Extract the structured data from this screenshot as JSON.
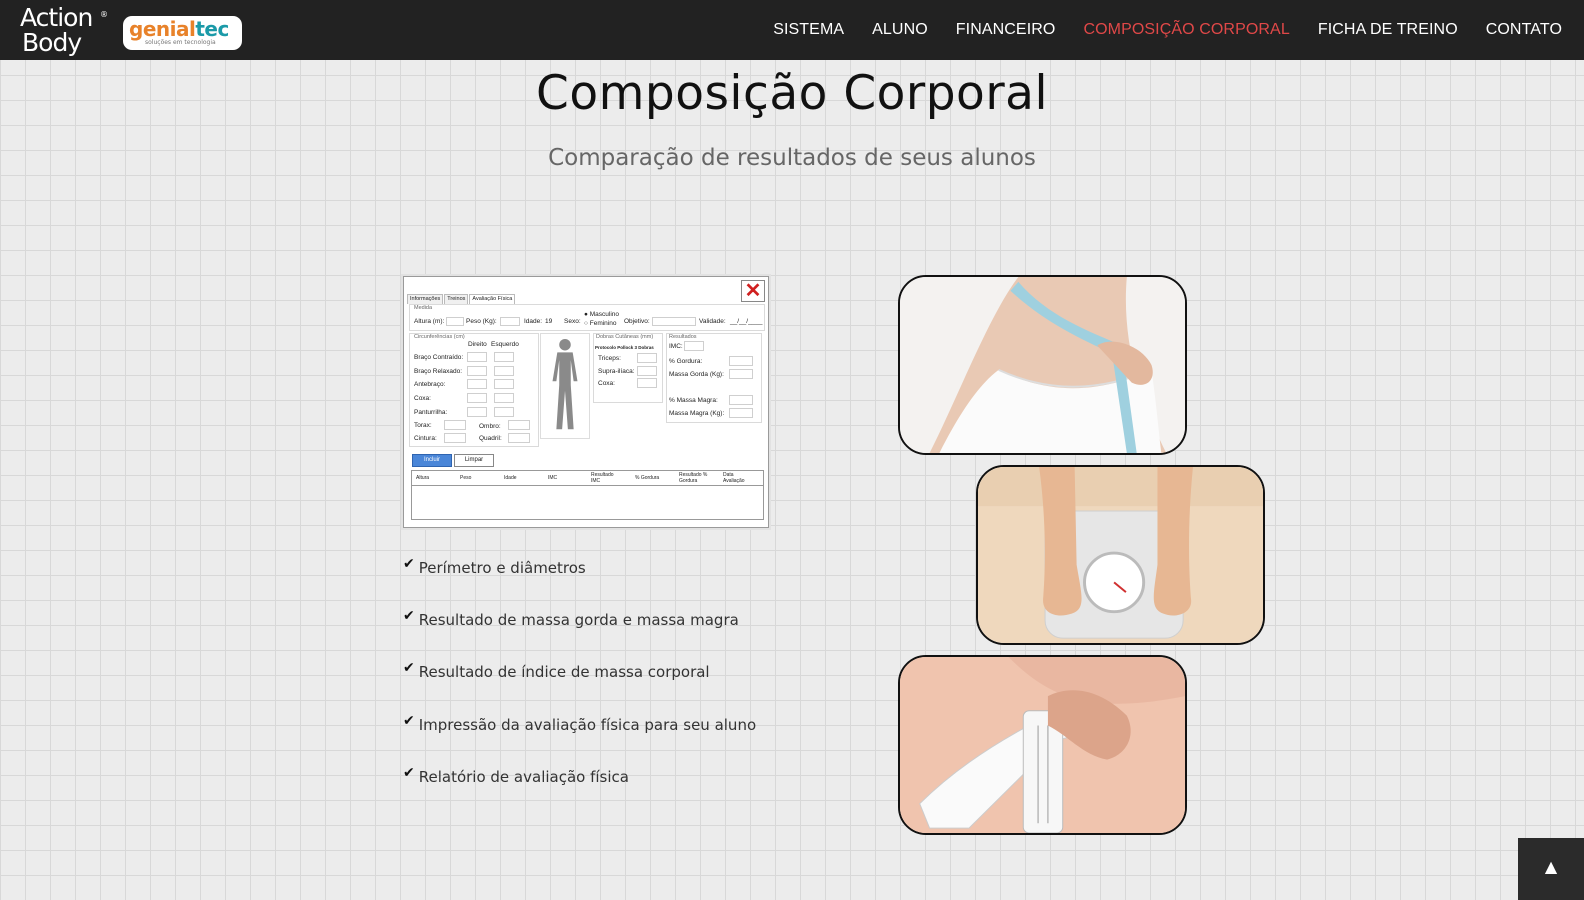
{
  "brand": {
    "action_line1": "Action",
    "action_line2": "Body",
    "action_reg": "®",
    "genial_part1": "genial",
    "genial_part2": "tec",
    "genial_tagline": "soluções em tecnologia"
  },
  "nav": {
    "items": [
      "SISTEMA",
      "ALUNO",
      "FINANCEIRO",
      "COMPOSIÇÃO CORPORAL",
      "FICHA DE TREINO",
      "CONTATO"
    ],
    "active": "COMPOSIÇÃO CORPORAL",
    "active_color": "#e04848"
  },
  "hero": {
    "title": "Composição Corporal",
    "subtitle": "Comparação de resultados de seus alunos"
  },
  "form": {
    "tabs": [
      "Informações",
      "Treinos",
      "Avaliação Física"
    ],
    "close_icon": "close-icon",
    "medida_label": "Medida",
    "altura_label": "Altura (m):",
    "peso_label": "Peso (Kg):",
    "idade_label": "Idade:",
    "idade_value": "19",
    "sexo_label": "Sexo:",
    "sexo_masc": "Masculino",
    "sexo_fem": "Feminino",
    "objetivo_label": "Objetivo:",
    "validade_label": "Validade:",
    "validade_value": "__/__/____",
    "circ_label": "Circunferências (cm)",
    "direito": "Direito",
    "esquerdo": "Esquerdo",
    "circ_rows": [
      "Braço Contraído:",
      "Braço Relaxado:",
      "Antebraço:",
      "Coxa:",
      "Panturrilha:"
    ],
    "torax": "Torax:",
    "ombro": "Ombro:",
    "cintura": "Cintura:",
    "quadril": "Quadril:",
    "dobras_label": "Dobras Cutâneas (mm)",
    "protocolo": "Protocolo Pollock 3 Dobras",
    "dobras_rows": [
      "Triceps:",
      "Supra-ilíaca:",
      "Coxa:"
    ],
    "resultados_label": "Resultados",
    "imc": "IMC:",
    "gordura": "% Gordura:",
    "massa_gorda": "Massa Gorda (Kg):",
    "massa_magra_pct": "% Massa Magra:",
    "massa_magra": "Massa Magra (Kg):",
    "btn_incluir": "Incluir",
    "btn_limpar": "Limpar",
    "table_headers": [
      "Altura",
      "Peso",
      "Idade",
      "IMC",
      "Resultado IMC",
      "% Gordura",
      "Resultado % Gordura",
      "Data Avaliação"
    ]
  },
  "features": [
    "Perímetro e diâmetros",
    "Resultado de massa gorda e massa magra",
    "Resultado de índice de massa corporal",
    "Impressão da avaliação física para seu aluno",
    "Relatório de avaliação física"
  ],
  "feature_icon": "check-icon",
  "photos": [
    "waist-measuring-tape-photo",
    "feet-on-scale-photo",
    "skinfold-caliper-photo"
  ],
  "back_to_top_icon": "chevron-up-icon"
}
